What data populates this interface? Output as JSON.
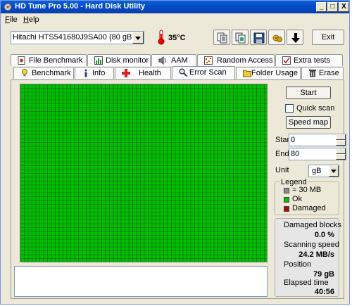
{
  "window": {
    "title": "HD Tune Pro 5.00 - Hard Disk Utility",
    "controls": {
      "minimize": "_",
      "maximize": "□",
      "close": "X"
    }
  },
  "menu": {
    "file": {
      "hotkey": "F",
      "rest": "ile"
    },
    "help": {
      "hotkey": "H",
      "rest": "elp"
    }
  },
  "toolbar": {
    "drive_selected": "Hitachi HTS541680J9SA00 (80 gB)",
    "temperature": "35°C",
    "exit_label": "Exit",
    "buttons": [
      "copy-icon",
      "copy-all-icon",
      "save-icon",
      "options-icon",
      "download-arrow-icon"
    ]
  },
  "tabs": {
    "row_top": [
      {
        "label": "File Benchmark",
        "icon": "file-benchmark-icon"
      },
      {
        "label": "Disk monitor",
        "icon": "disk-monitor-icon"
      },
      {
        "label": "AAM",
        "icon": "speaker-icon"
      },
      {
        "label": "Random Access",
        "icon": "random-access-icon"
      },
      {
        "label": "Extra tests",
        "icon": "extra-tests-icon"
      }
    ],
    "row_bottom": [
      {
        "label": "Benchmark",
        "icon": "benchmark-icon"
      },
      {
        "label": "Info",
        "icon": "info-icon"
      },
      {
        "label": "Health",
        "icon": "health-cross-icon"
      },
      {
        "label": "Error Scan",
        "icon": "magnifier-icon"
      },
      {
        "label": "Folder Usage",
        "icon": "folder-icon"
      },
      {
        "label": "Erase",
        "icon": "trash-icon"
      }
    ],
    "active": "Error Scan"
  },
  "scan": {
    "start_label": "Start",
    "quick_scan_label": "Quick scan",
    "quick_scan_checked": false,
    "speed_map_label": "Speed map",
    "start_field_label": "Start",
    "start_value": "0",
    "end_field_label": "End",
    "end_value": "80",
    "unit_label": "Unit",
    "unit_value": "gB",
    "grid_color": "#00c000",
    "grid_line_color": "#1a5a1a"
  },
  "legend": {
    "title": "Legend",
    "items": [
      {
        "label": "= 30 MB",
        "color": "#8c8c8c"
      },
      {
        "label": "Ok",
        "color": "#00c000"
      },
      {
        "label": "Damaged",
        "color": "#c00000"
      }
    ]
  },
  "stats": {
    "damaged_blocks_label": "Damaged blocks",
    "damaged_blocks_value": "0.0 %",
    "scanning_speed_label": "Scanning speed",
    "scanning_speed_value": "24.2 MB/s",
    "position_label": "Position",
    "position_value": "79 gB",
    "elapsed_label": "Elapsed time",
    "elapsed_value": "40:56"
  }
}
